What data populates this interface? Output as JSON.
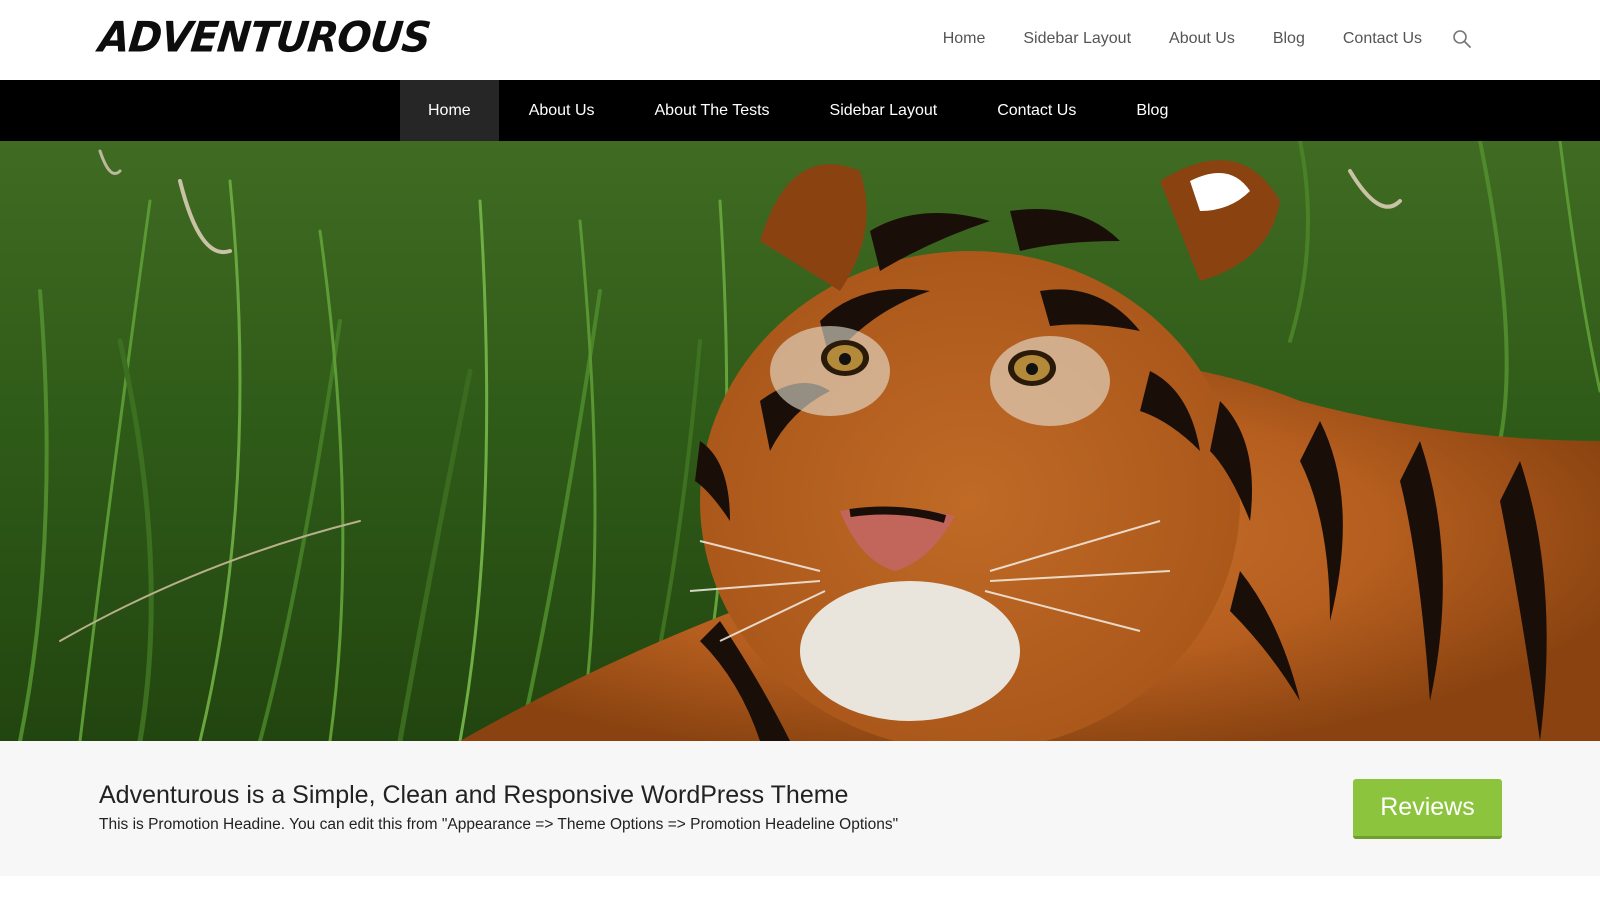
{
  "site": {
    "logo_text": "ADVENTUROUS"
  },
  "top_nav": {
    "items": [
      {
        "label": "Home"
      },
      {
        "label": "Sidebar Layout"
      },
      {
        "label": "About Us"
      },
      {
        "label": "Blog"
      },
      {
        "label": "Contact Us"
      }
    ],
    "search_icon": "search-icon"
  },
  "main_menu": {
    "items": [
      {
        "label": "Home",
        "active": true
      },
      {
        "label": "About The Tests"
      },
      {
        "label": "About Us"
      },
      {
        "label": "Sidebar Layout"
      },
      {
        "label": "Contact Us"
      },
      {
        "label": "Blog"
      }
    ]
  },
  "slider": {
    "image": "tiger-in-grass",
    "dots": [
      {
        "active": true,
        "color": "#ffffff"
      },
      {
        "active": false,
        "color": "#8cc43d"
      }
    ]
  },
  "promotion": {
    "headline": "Adventurous is a Simple, Clean and Responsive WordPress Theme",
    "subtext": "This is Promotion Headine. You can edit this from \"Appearance => Theme Options => Promotion Headeline Options\"",
    "button_label": "Reviews",
    "button_color": "#8cc43d"
  }
}
